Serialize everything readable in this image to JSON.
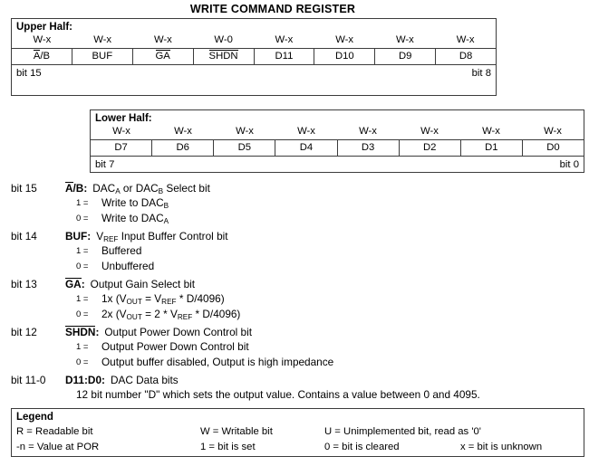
{
  "title": "WRITE COMMAND REGISTER",
  "upper_half": {
    "label": "Upper Half:",
    "attrs": [
      "W-x",
      "W-x",
      "W-x",
      "W-0",
      "W-x",
      "W-x",
      "W-x",
      "W-x"
    ],
    "names": [
      "A/B",
      "BUF",
      "GA",
      "SHDN",
      "D11",
      "D10",
      "D9",
      "D8"
    ],
    "bit_left": "bit 15",
    "bit_right": "bit 8"
  },
  "lower_half": {
    "label": "Lower Half:",
    "attrs": [
      "W-x",
      "W-x",
      "W-x",
      "W-x",
      "W-x",
      "W-x",
      "W-x",
      "W-x"
    ],
    "names": [
      "D7",
      "D6",
      "D5",
      "D4",
      "D3",
      "D2",
      "D1",
      "D0"
    ],
    "bit_left": "bit 7",
    "bit_right": "bit 0"
  },
  "bits": [
    {
      "index": "bit 15",
      "name": "A/B:",
      "description": "DACA or DACB Select bit",
      "one_label": "1 =",
      "one_value": "Write to DACB",
      "zero_label": "0 =",
      "zero_value": "Write to DACA"
    },
    {
      "index": "bit 14",
      "name": "BUF:",
      "description": "VREF Input Buffer Control bit",
      "one_label": "1 =",
      "one_value": "Buffered",
      "zero_label": "0 =",
      "zero_value": "Unbuffered"
    },
    {
      "index": "bit 13",
      "name": "GA:",
      "description": "Output Gain Select bit",
      "one_label": "1 =",
      "one_value": "1x (VOUT = VREF * D/4096)",
      "zero_label": "0 =",
      "zero_value": "2x (VOUT = 2 * VREF * D/4096)"
    },
    {
      "index": "bit 12",
      "name": "SHDN:",
      "description": "Output Power Down Control bit",
      "one_label": "1 =",
      "one_value": "Output Power Down Control bit",
      "zero_label": "0 =",
      "zero_value": "Output buffer disabled, Output is high impedance"
    },
    {
      "index": "bit 11-0",
      "name": "D11:D0:",
      "description": "DAC Data bits",
      "note": "12 bit number \"D\" which sets the output value. Contains a value between 0 and 4095."
    }
  ],
  "legend": {
    "title": "Legend",
    "row1": [
      "R = Readable bit",
      "W = Writable bit",
      "U = Unimplemented bit, read as '0'"
    ],
    "row2": [
      "-n = Value at POR",
      "1 = bit is set",
      "0 = bit is cleared",
      "x = bit is unknown"
    ]
  },
  "colors": {
    "border": "#3c3c3c",
    "text": "#000000",
    "background": "#ffffff"
  }
}
